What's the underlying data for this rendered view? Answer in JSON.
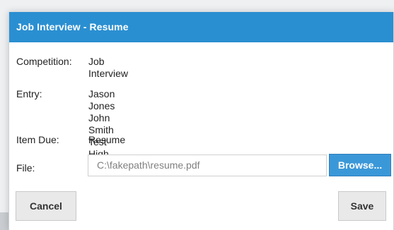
{
  "dialog": {
    "title": "Job Interview - Resume",
    "fields": {
      "competition_label": "Competition:",
      "competition_value": "Job Interview",
      "entry_label": "Entry:",
      "entry_lines": "Jason Jones\nJohn Smith\nTest High School",
      "item_due_label": "Item Due:",
      "item_due_value": "Resume",
      "file_label": "File:",
      "file_value": "C:\\fakepath\\resume.pdf"
    },
    "buttons": {
      "browse": "Browse...",
      "cancel": "Cancel",
      "save": "Save"
    }
  },
  "colors": {
    "header_blue": "#2a8fd1",
    "browse_blue": "#3b98d8",
    "button_gray": "#e9e9e9"
  },
  "icons": {
    "background_hint": "partial-text"
  }
}
